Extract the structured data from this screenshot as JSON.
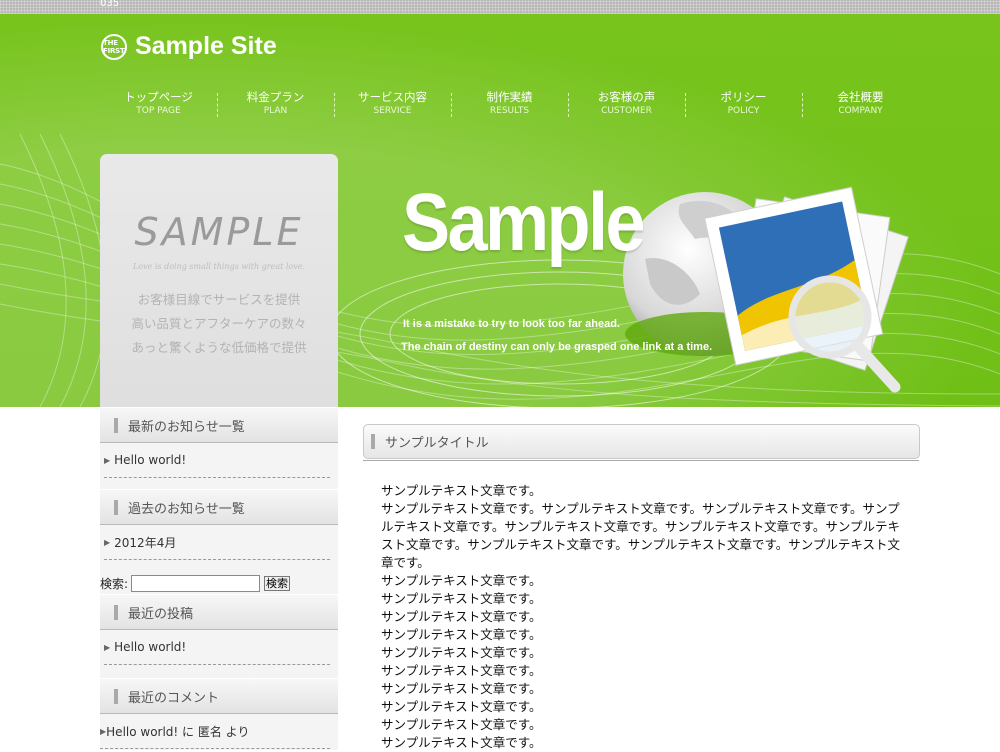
{
  "top_strip": {
    "code": "035"
  },
  "header": {
    "logo_badge": "THE FIRST",
    "site_name": "Sample Site"
  },
  "nav": [
    {
      "jp": "トップページ",
      "en": "TOP PAGE"
    },
    {
      "jp": "料金プラン",
      "en": "PLAN"
    },
    {
      "jp": "サービス内容",
      "en": "SERVICE"
    },
    {
      "jp": "制作実績",
      "en": "RESULTS"
    },
    {
      "jp": "お客様の声",
      "en": "CUSTOMER"
    },
    {
      "jp": "ポリシー",
      "en": "POLICY"
    },
    {
      "jp": "会社概要",
      "en": "COMPANY"
    }
  ],
  "sample_box": {
    "title": "SAMPLE",
    "script": "Love is doing small things with great love.",
    "lines": [
      "お客様目線でサービスを提供",
      "高い品質とアフターケアの数々",
      "あっと驚くような低価格で提供"
    ]
  },
  "banner": {
    "title": "Sample",
    "tagline_1": "It is a mistake to try to look too far ahead.",
    "tagline_2": "The chain of destiny can only be grasped one link at a time."
  },
  "sidebar": {
    "news_title": "最新のお知らせ一覧",
    "news_items": [
      "Hello world!"
    ],
    "archive_title": "過去のお知らせ一覧",
    "archive_items": [
      "2012年4月"
    ],
    "search_label": "検索:",
    "search_value": "",
    "search_button": "検索",
    "recent_posts_title": "最近の投稿",
    "recent_posts": [
      "Hello world!"
    ],
    "recent_comments_title": "最近のコメント",
    "recent_comment": "Hello world! に 匿名 より"
  },
  "main": {
    "title": "サンプルタイトル",
    "paragraphs": [
      "サンプルテキスト文章です。",
      "サンプルテキスト文章です。サンプルテキスト文章です。サンプルテキスト文章です。サンプルテキスト文章です。サンプルテキスト文章です。サンプルテキスト文章です。サンプルテキスト文章です。サンプルテキスト文章です。サンプルテキスト文章です。サンプルテキスト文章です。",
      "サンプルテキスト文章です。",
      "サンプルテキスト文章です。",
      "サンプルテキスト文章です。",
      "サンプルテキスト文章です。",
      "サンプルテキスト文章です。",
      "サンプルテキスト文章です。",
      "サンプルテキスト文章です。",
      "サンプルテキスト文章です。",
      "サンプルテキスト文章です。",
      "サンプルテキスト文章です。"
    ]
  },
  "colors": {
    "brand_green": "#74c219",
    "sidebar_grey": "#e3e3e3"
  }
}
